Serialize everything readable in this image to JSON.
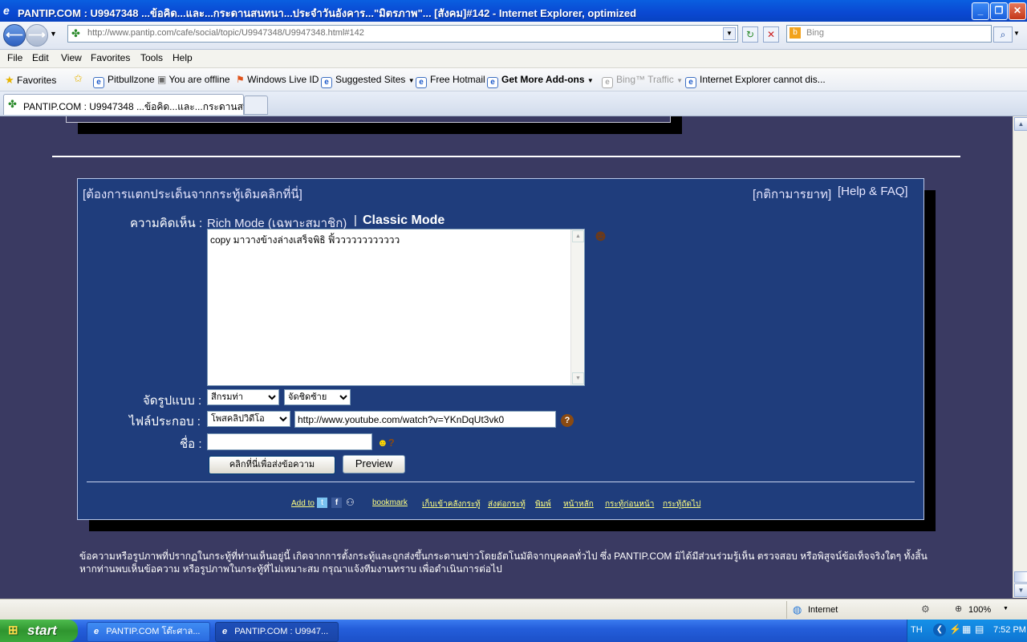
{
  "window": {
    "title": "PANTIP.COM : U9947348 ...ข้อคิด...และ...กระดานสนทนา...ประจำวันอังคาร...\"มิตรภาพ\"... [สังคม]#142 - Internet Explorer, optimized"
  },
  "address": {
    "url": "http://www.pantip.com/cafe/social/topic/U9947348/U9947348.html#142",
    "search_placeholder": "Bing"
  },
  "menu": [
    "File",
    "Edit",
    "View",
    "Favorites",
    "Tools",
    "Help"
  ],
  "favorites": {
    "label": "Favorites",
    "items": [
      "Pitbullzone",
      "You are offline",
      "Windows Live ID",
      "Suggested Sites",
      "Free Hotmail",
      "Get More Add-ons",
      "Bing™ Traffic",
      "Internet Explorer cannot dis..."
    ]
  },
  "tabs": {
    "active": "PANTIP.COM : U9947348 ...ข้อคิด...และ...กระดานสน..."
  },
  "page": {
    "split_link": "[ต้องการแตกประเด็นจากกระทู้เดิมคลิกที่นี่]",
    "rules_link": "[กติกามารยาท]",
    "help_link": "[Help & FAQ]",
    "comment_label": "ความคิดเห็น :",
    "rich_mode": "Rich Mode (เฉพาะสมาชิก)",
    "mode_sep": "|",
    "classic_mode": "Classic Mode",
    "comment_text": "copy มาวางข้างล่างเสร็จพิธิ ฟิ้วววววววววววว",
    "format_label": "จัดรูปแบบ :",
    "color_select": "สีกรมท่า",
    "align_select": "จัดชิดซ้าย",
    "attach_label": "ไฟล์ประกอบ :",
    "attach_select": "โพสคลิปวิดีโอ",
    "attach_url": "http://www.youtube.com/watch?v=YKnDqUt3vk0",
    "name_label": "ชื่อ :",
    "name_value": "",
    "submit_label": "คลิกที่นี่เพื่อส่งข้อความ",
    "preview_label": "Preview",
    "footer_links": {
      "add_to": "Add to",
      "bookmark": "bookmark",
      "save": "เก็บเข้าคลังกระทู้",
      "forward": "ส่งต่อกระทู้",
      "print": "พิมพ์",
      "home": "หน้าหลัก",
      "prev": "กระทู้ก่อนหน้า",
      "next": "กระทู้ถัดไป"
    },
    "disclaimer": "ข้อความหรือรูปภาพที่ปรากฏในกระทู้ที่ท่านเห็นอยู่นี้ เกิดจากการตั้งกระทู้และถูกส่งขึ้นกระดานข่าวโดยอัตโนมัติจากบุคคลทั่วไป ซึ่ง PANTIP.COM มิได้มีส่วนร่วมรู้เห็น ตรวจสอบ หรือพิสูจน์ข้อเท็จจริงใดๆ ทั้งสิ้น หากท่านพบเห็นข้อความ หรือรูปภาพในกระทู้ที่ไม่เหมาะสม กรุณาแจ้งทีมงานทราบ เพื่อดำเนินการต่อไป"
  },
  "status": {
    "zone": "Internet",
    "zoom": "100%"
  },
  "taskbar": {
    "start": "start",
    "tasks": [
      "PANTIP.COM โต๊ะศาล...",
      "PANTIP.COM : U9947..."
    ],
    "lang": "TH",
    "time": "7:52 PM"
  }
}
